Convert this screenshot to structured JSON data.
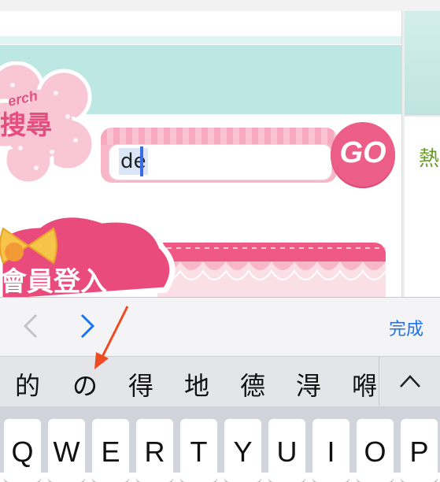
{
  "webpage": {
    "search": {
      "badge_small": "erch",
      "badge_label": "搜尋",
      "input_value": "de",
      "go_label": "GO"
    },
    "login": {
      "label": "會員登入"
    },
    "side_text": "熱"
  },
  "accessory_bar": {
    "prev_icon": "chevron-left-icon",
    "next_icon": "chevron-right-icon",
    "done_label": "完成"
  },
  "candidates": {
    "items": [
      "的",
      "の",
      "得",
      "地",
      "德",
      "淂",
      "嘚"
    ],
    "expand_icon": "chevron-up-icon"
  },
  "keyboard": {
    "row1": [
      "Q",
      "W",
      "E",
      "R",
      "T",
      "Y",
      "U",
      "I",
      "O",
      "P"
    ]
  },
  "colors": {
    "teal": "#bde7e3",
    "pink": "#ec5d88",
    "link_blue": "#1a74f2",
    "side_green": "#6a9a2a",
    "arrow_red": "#ee4b22"
  }
}
